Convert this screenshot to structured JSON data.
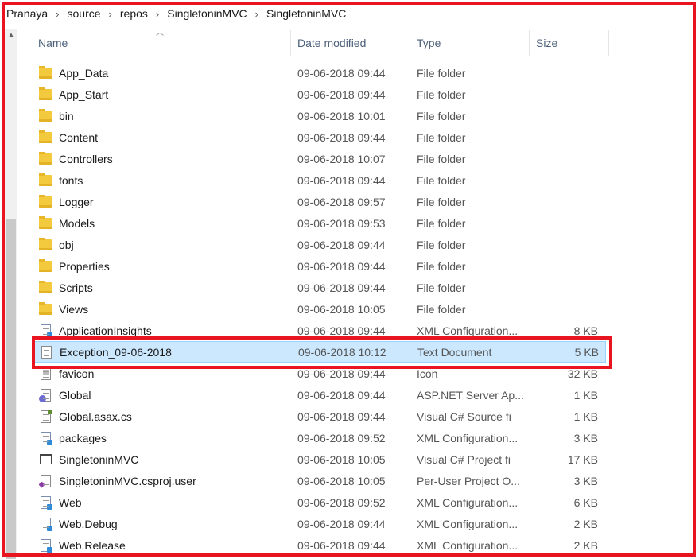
{
  "breadcrumb": [
    "Pranaya",
    "source",
    "repos",
    "SingletoninMVC",
    "SingletoninMVC"
  ],
  "columns": {
    "name": "Name",
    "date": "Date modified",
    "type": "Type",
    "size": "Size"
  },
  "rows": [
    {
      "name": "App_Data",
      "date": "09-06-2018 09:44",
      "type": "File folder",
      "size": "",
      "icon": "folder-icon"
    },
    {
      "name": "App_Start",
      "date": "09-06-2018 09:44",
      "type": "File folder",
      "size": "",
      "icon": "folder-icon"
    },
    {
      "name": "bin",
      "date": "09-06-2018 10:01",
      "type": "File folder",
      "size": "",
      "icon": "folder-icon"
    },
    {
      "name": "Content",
      "date": "09-06-2018 09:44",
      "type": "File folder",
      "size": "",
      "icon": "folder-icon"
    },
    {
      "name": "Controllers",
      "date": "09-06-2018 10:07",
      "type": "File folder",
      "size": "",
      "icon": "folder-icon"
    },
    {
      "name": "fonts",
      "date": "09-06-2018 09:44",
      "type": "File folder",
      "size": "",
      "icon": "folder-icon"
    },
    {
      "name": "Logger",
      "date": "09-06-2018 09:57",
      "type": "File folder",
      "size": "",
      "icon": "folder-icon"
    },
    {
      "name": "Models",
      "date": "09-06-2018 09:53",
      "type": "File folder",
      "size": "",
      "icon": "folder-icon"
    },
    {
      "name": "obj",
      "date": "09-06-2018 09:44",
      "type": "File folder",
      "size": "",
      "icon": "folder-icon"
    },
    {
      "name": "Properties",
      "date": "09-06-2018 09:44",
      "type": "File folder",
      "size": "",
      "icon": "folder-icon"
    },
    {
      "name": "Scripts",
      "date": "09-06-2018 09:44",
      "type": "File folder",
      "size": "",
      "icon": "folder-icon"
    },
    {
      "name": "Views",
      "date": "09-06-2018 10:05",
      "type": "File folder",
      "size": "",
      "icon": "folder-icon"
    },
    {
      "name": "ApplicationInsights",
      "date": "09-06-2018 09:44",
      "type": "XML Configuration...",
      "size": "8 KB",
      "icon": "xml-config-icon"
    },
    {
      "name": "Exception_09-06-2018",
      "date": "09-06-2018 10:12",
      "type": "Text Document",
      "size": "5 KB",
      "icon": "text-document-icon",
      "selected": true
    },
    {
      "name": "favicon",
      "date": "09-06-2018 09:44",
      "type": "Icon",
      "size": "32 KB",
      "icon": "favicon-icon"
    },
    {
      "name": "Global",
      "date": "09-06-2018 09:44",
      "type": "ASP.NET Server Ap...",
      "size": "1 KB",
      "icon": "aspnet-icon"
    },
    {
      "name": "Global.asax.cs",
      "date": "09-06-2018 09:44",
      "type": "Visual C# Source fi",
      "size": "1 KB",
      "icon": "csharp-source-icon"
    },
    {
      "name": "packages",
      "date": "09-06-2018 09:52",
      "type": "XML Configuration...",
      "size": "3 KB",
      "icon": "xml-config-icon"
    },
    {
      "name": "SingletoninMVC",
      "date": "09-06-2018 10:05",
      "type": "Visual C# Project fi",
      "size": "17 KB",
      "icon": "csharp-project-icon"
    },
    {
      "name": "SingletoninMVC.csproj.user",
      "date": "09-06-2018 10:05",
      "type": "Per-User Project O...",
      "size": "3 KB",
      "icon": "user-project-icon"
    },
    {
      "name": "Web",
      "date": "09-06-2018 09:52",
      "type": "XML Configuration...",
      "size": "6 KB",
      "icon": "xml-config-icon"
    },
    {
      "name": "Web.Debug",
      "date": "09-06-2018 09:44",
      "type": "XML Configuration...",
      "size": "2 KB",
      "icon": "xml-config-icon"
    },
    {
      "name": "Web.Release",
      "date": "09-06-2018 09:44",
      "type": "XML Configuration...",
      "size": "2 KB",
      "icon": "xml-config-icon"
    }
  ],
  "colors": {
    "selection": "#cce8ff",
    "annotation": "#e8141f",
    "folder": "#f3c93d"
  }
}
